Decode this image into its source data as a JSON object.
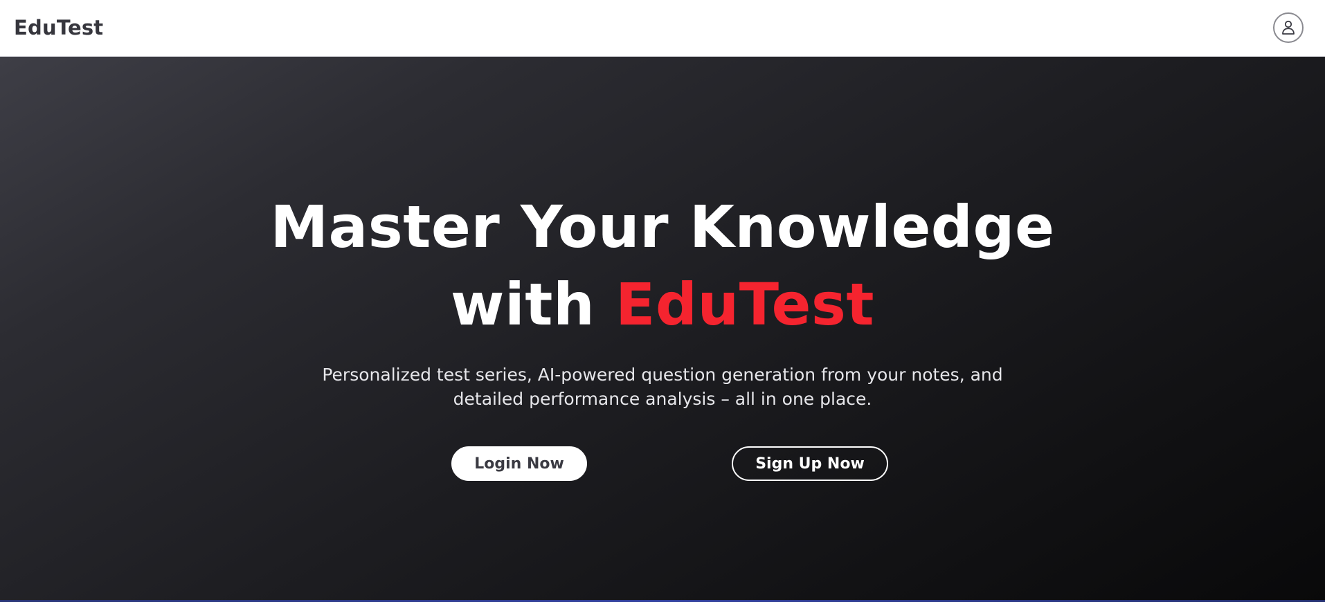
{
  "header": {
    "brand": "EduTest",
    "profile_icon": "user-icon"
  },
  "hero": {
    "headline_line1": "Master Your Knowledge",
    "headline_with": "with ",
    "headline_accent": "EduTest",
    "subtitle_line1": "Personalized test series, AI-powered question generation from your notes, and",
    "subtitle_line2": "detailed performance analysis – all in one place.",
    "login_label": "Login Now",
    "signup_label": "Sign Up Now"
  },
  "colors": {
    "accent": "#f5242f",
    "header_bg": "#ffffff",
    "brand_text": "#36363d",
    "hero_bg_dark": "#0b0b0d"
  }
}
